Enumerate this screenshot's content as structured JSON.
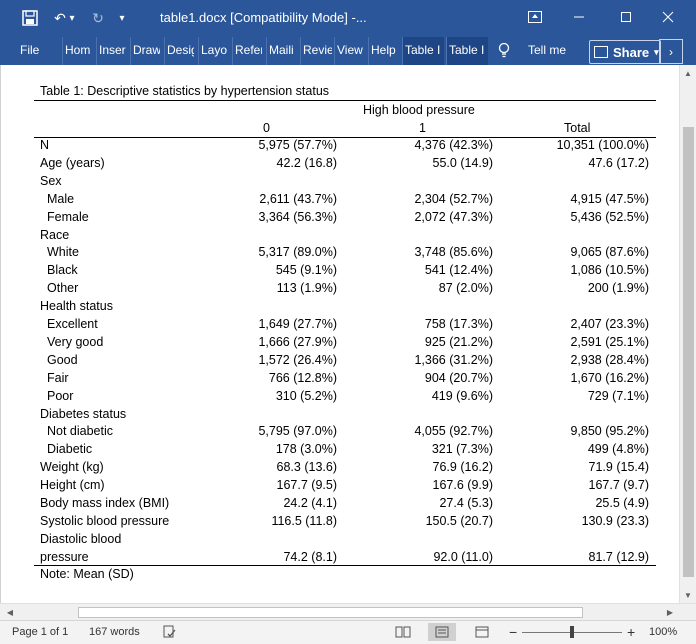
{
  "window": {
    "title": "table1.docx [Compatibility Mode]  -...",
    "minimize": "—",
    "restore": "☐",
    "close": "✕",
    "ribbon_display": "⬆"
  },
  "quick_access": {
    "save": "💾",
    "undo": "↶",
    "undo_dropdown": "▾",
    "redo": "↻",
    "customize": "▾"
  },
  "ribbon": {
    "tabs": [
      "File",
      "Hom",
      "Inser",
      "Draw",
      "Desig",
      "Layo",
      "Refer",
      "Maili",
      "Revie",
      "View",
      "Help",
      "Table I",
      "Table I"
    ],
    "tell_me": "Tell me",
    "share": "Share",
    "share_caret": "⌄",
    "more": "›"
  },
  "document": {
    "caption": "Table 1: Descriptive statistics by hypertension status",
    "group_header": "High blood pressure",
    "columns": [
      "0",
      "1",
      "Total"
    ],
    "rows": [
      {
        "label": "N",
        "indent": false,
        "v": [
          "5,975 (57.7%)",
          "4,376 (42.3%)",
          "10,351 (100.0%)"
        ]
      },
      {
        "label": "Age (years)",
        "indent": false,
        "v": [
          "42.2 (16.8)",
          "55.0 (14.9)",
          "47.6 (17.2)"
        ]
      },
      {
        "label": "Sex",
        "indent": false,
        "v": [
          "",
          "",
          ""
        ]
      },
      {
        "label": "Male",
        "indent": true,
        "v": [
          "2,611 (43.7%)",
          "2,304 (52.7%)",
          "4,915 (47.5%)"
        ]
      },
      {
        "label": "Female",
        "indent": true,
        "v": [
          "3,364 (56.3%)",
          "2,072 (47.3%)",
          "5,436 (52.5%)"
        ]
      },
      {
        "label": "Race",
        "indent": false,
        "v": [
          "",
          "",
          ""
        ]
      },
      {
        "label": "White",
        "indent": true,
        "v": [
          "5,317 (89.0%)",
          "3,748 (85.6%)",
          "9,065 (87.6%)"
        ]
      },
      {
        "label": "Black",
        "indent": true,
        "v": [
          "545 (9.1%)",
          "541 (12.4%)",
          "1,086 (10.5%)"
        ]
      },
      {
        "label": "Other",
        "indent": true,
        "v": [
          "113 (1.9%)",
          "87 (2.0%)",
          "200 (1.9%)"
        ]
      },
      {
        "label": "Health status",
        "indent": false,
        "v": [
          "",
          "",
          ""
        ]
      },
      {
        "label": "Excellent",
        "indent": true,
        "v": [
          "1,649 (27.7%)",
          "758 (17.3%)",
          "2,407 (23.3%)"
        ]
      },
      {
        "label": "Very good",
        "indent": true,
        "v": [
          "1,666 (27.9%)",
          "925 (21.2%)",
          "2,591 (25.1%)"
        ]
      },
      {
        "label": "Good",
        "indent": true,
        "v": [
          "1,572 (26.4%)",
          "1,366 (31.2%)",
          "2,938 (28.4%)"
        ]
      },
      {
        "label": "Fair",
        "indent": true,
        "v": [
          "766 (12.8%)",
          "904 (20.7%)",
          "1,670 (16.2%)"
        ]
      },
      {
        "label": "Poor",
        "indent": true,
        "v": [
          "310 (5.2%)",
          "419 (9.6%)",
          "729 (7.1%)"
        ]
      },
      {
        "label": "Diabetes status",
        "indent": false,
        "v": [
          "",
          "",
          ""
        ]
      },
      {
        "label": "Not diabetic",
        "indent": true,
        "v": [
          "5,795 (97.0%)",
          "4,055 (92.7%)",
          "9,850 (95.2%)"
        ]
      },
      {
        "label": "Diabetic",
        "indent": true,
        "v": [
          "178 (3.0%)",
          "321 (7.3%)",
          "499 (4.8%)"
        ]
      },
      {
        "label": "Weight (kg)",
        "indent": false,
        "v": [
          "68.3 (13.6)",
          "76.9 (16.2)",
          "71.9 (15.4)"
        ]
      },
      {
        "label": "Height (cm)",
        "indent": false,
        "v": [
          "167.7 (9.5)",
          "167.6 (9.9)",
          "167.7 (9.7)"
        ]
      },
      {
        "label": "Body mass index (BMI)",
        "indent": false,
        "v": [
          "24.2 (4.1)",
          "27.4 (5.3)",
          "25.5 (4.9)"
        ]
      },
      {
        "label": "Systolic blood pressure",
        "indent": false,
        "v": [
          "116.5 (11.8)",
          "150.5 (20.7)",
          "130.9 (23.3)"
        ]
      },
      {
        "label": "Diastolic blood",
        "indent": false,
        "v": [
          "",
          "",
          ""
        ]
      },
      {
        "label": "pressure",
        "indent": false,
        "v": [
          "74.2 (8.1)",
          "92.0 (11.0)",
          "81.7 (12.9)"
        ]
      }
    ],
    "note": "Note: Mean (SD)"
  },
  "status": {
    "page": "Page 1 of 1",
    "words": "167 words",
    "zoom_minus": "−",
    "zoom_plus": "+",
    "zoom": "100%"
  }
}
